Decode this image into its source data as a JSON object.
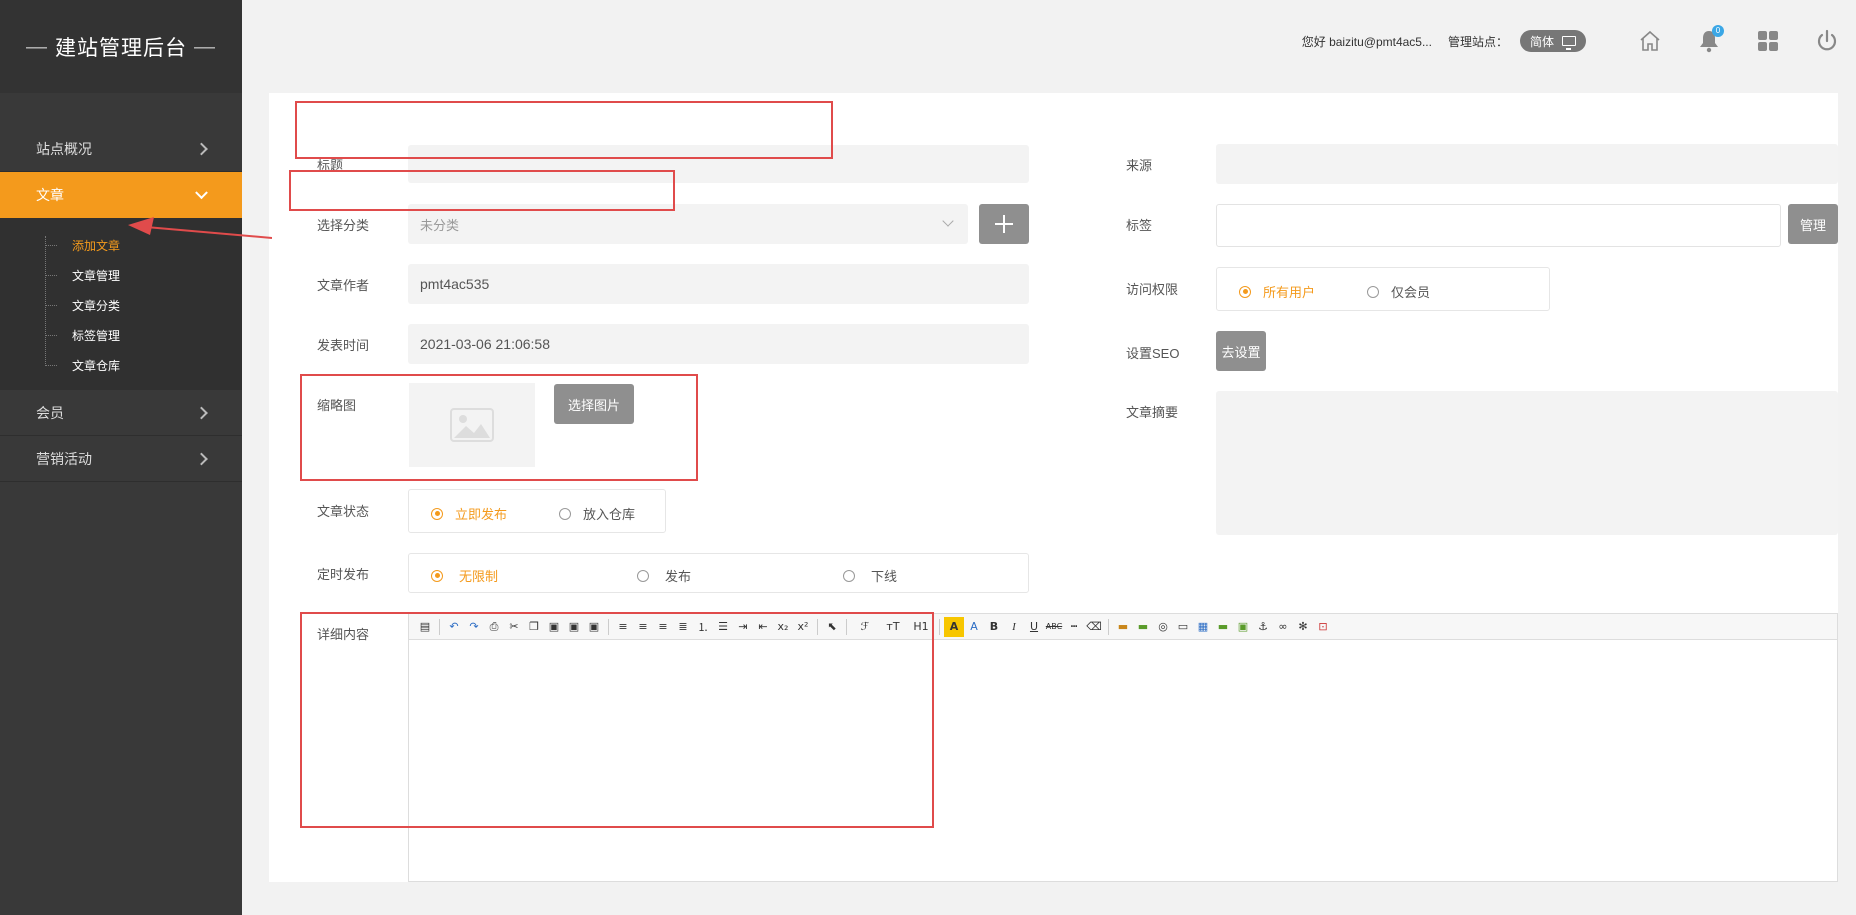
{
  "brand": {
    "dash_left": "—",
    "title": "建站管理后台",
    "dash_right": "—"
  },
  "sidebar": {
    "items": [
      {
        "label": "站点概况"
      },
      {
        "label": "文章"
      },
      {
        "label": "会员"
      },
      {
        "label": "营销活动"
      }
    ],
    "sub_items": [
      {
        "label": "添加文章"
      },
      {
        "label": "文章管理"
      },
      {
        "label": "文章分类"
      },
      {
        "label": "标签管理"
      },
      {
        "label": "文章仓库"
      }
    ]
  },
  "topbar": {
    "greeting": "您好 baizitu@pmt4ac5...",
    "site_label": "管理站点：",
    "language": "简体",
    "notification_count": "0"
  },
  "form": {
    "title_label": "标题",
    "title_value": "",
    "category_label": "选择分类",
    "category_value": "未分类",
    "author_label": "文章作者",
    "author_value": "pmt4ac535",
    "publish_time_label": "发表时间",
    "publish_time_value": "2021-03-06 21:06:58",
    "thumbnail_label": "缩略图",
    "select_image_button": "选择图片",
    "status_label": "文章状态",
    "status_options": [
      "立即发布",
      "放入仓库"
    ],
    "schedule_label": "定时发布",
    "schedule_options": [
      "无限制",
      "发布",
      "下线"
    ],
    "content_label": "详细内容",
    "source_label": "来源",
    "source_value": "",
    "tags_label": "标签",
    "tags_manage_button": "管理",
    "access_label": "访问权限",
    "access_options": [
      "所有用户",
      "仅会员"
    ],
    "seo_label": "设置SEO",
    "seo_button": "去设置",
    "summary_label": "文章摘要"
  },
  "editor_toolbar": {
    "font_family": "ℱ",
    "font_size": "тT",
    "heading": "H1",
    "highlight": "A",
    "font_color": "A",
    "bold": "B",
    "italic": "I",
    "underline": "U",
    "strikethrough": "ABC",
    "subscript": "x₂",
    "superscript": "x²"
  },
  "colors": {
    "accent": "#f49a1c",
    "sidebar_bg": "#393939",
    "annotation_red": "#e04b4b"
  }
}
